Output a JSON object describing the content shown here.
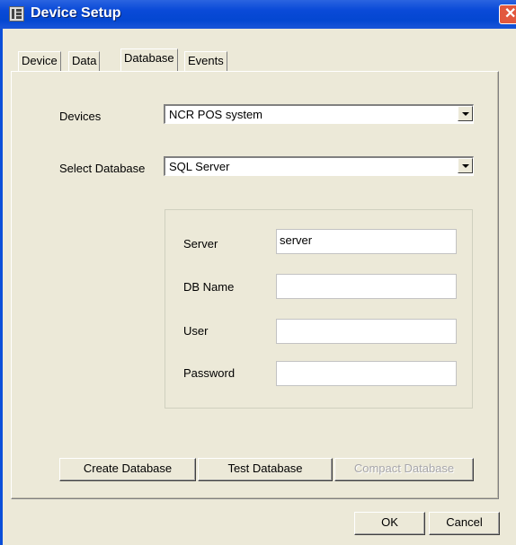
{
  "window": {
    "title": "Device Setup",
    "close_symbol": "✕"
  },
  "tabs": [
    {
      "label": "Device",
      "active": false
    },
    {
      "label": "Data",
      "active": false
    },
    {
      "label": "Database",
      "active": true
    },
    {
      "label": "Events",
      "active": false
    }
  ],
  "form": {
    "devices_label": "Devices",
    "devices_value": "NCR POS system",
    "select_db_label": "Select Database",
    "select_db_value": "SQL Server",
    "server_label": "Server",
    "server_value": "server",
    "dbname_label": "DB Name",
    "dbname_value": "",
    "user_label": "User",
    "user_value": "",
    "password_label": "Password",
    "password_value": ""
  },
  "buttons": {
    "create_db": "Create Database",
    "test_db": "Test Database",
    "compact_db": "Compact Database",
    "ok": "OK",
    "cancel": "Cancel"
  }
}
